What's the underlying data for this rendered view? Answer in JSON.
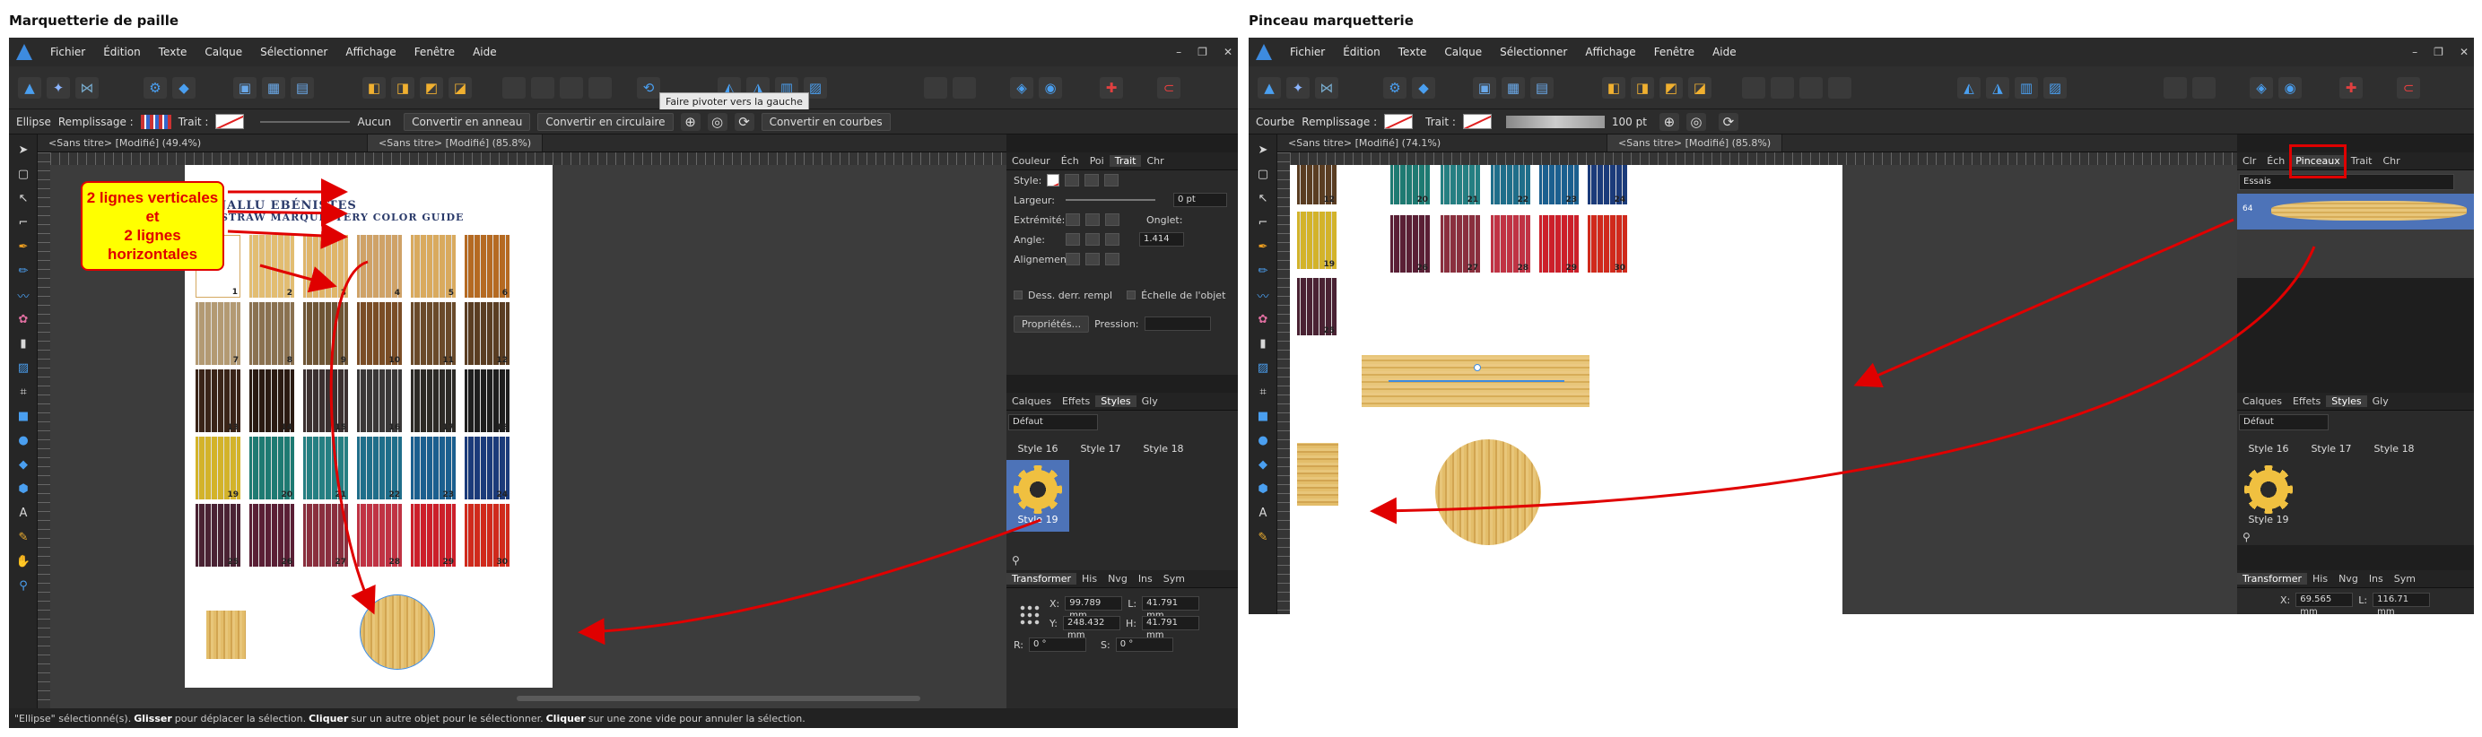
{
  "page_titles": {
    "left": "Marquetterie de paille",
    "right": "Pinceau marquetterie"
  },
  "menu": [
    "Fichier",
    "Édition",
    "Texte",
    "Calque",
    "Sélectionner",
    "Affichage",
    "Fenêtre",
    "Aide"
  ],
  "window_controls": {
    "minimize": "–",
    "restore": "❐",
    "close": "✕"
  },
  "left": {
    "context": {
      "tool": "Ellipse",
      "fill_label": "Remplissage :",
      "stroke_label": "Trait :",
      "stroke_value": "Aucun",
      "btn_ring": "Convertir en anneau",
      "btn_circular": "Convertir en circulaire",
      "btn_curves": "Convertir en courbes"
    },
    "tooltip": "Faire pivoter vers la gauche",
    "tabs": [
      "<Sans titre> [Modifié] (49.4%)",
      "<Sans titre> [Modifié] (85.8%)"
    ],
    "stroke_panel": {
      "tabs": [
        "Couleur",
        "Éch",
        "Poi",
        "Trait",
        "Chr"
      ],
      "style_label": "Style:",
      "rows": [
        {
          "label": "Largeur:",
          "value": "0 pt"
        },
        {
          "label": "Extrémité:",
          "extra_label": "Onglet:"
        },
        {
          "label": "Angle:",
          "extra_value": "1.414"
        },
        {
          "label": "Alignement:"
        }
      ],
      "check1": "Dess. derr. rempl",
      "check2": "Échelle de l'objet",
      "props_button": "Propriétés...",
      "pressure_label": "Pression:"
    },
    "styles_panel": {
      "tabs": [
        "Calques",
        "Effets",
        "Styles",
        "Gly"
      ],
      "category": "Défaut",
      "items": [
        "Style 16",
        "Style 17",
        "Style 18",
        "Style 19"
      ]
    },
    "transform_panel": {
      "tabs": [
        "Transformer",
        "His",
        "Nvg",
        "Ins",
        "Sym"
      ],
      "x_label": "X:",
      "x": "99.789 mm",
      "y_label": "Y:",
      "y": "248.432 mm",
      "w_label": "L:",
      "w": "41.791 mm",
      "h_label": "H:",
      "h": "41.791 mm",
      "r_label": "R:",
      "r": "0 °",
      "s_label": "S:",
      "s": "0 °"
    },
    "document": {
      "brand": "JALLU EBÉNISTES",
      "subtitle": "STRAW MARQUETTERY COLOR GUIDE"
    },
    "swatches": [
      {
        "n": "1",
        "color": "#ffffff"
      },
      {
        "n": "2",
        "color": "#e2bd72"
      },
      {
        "n": "3",
        "color": "#dfb56a"
      },
      {
        "n": "4",
        "color": "#cfa267"
      },
      {
        "n": "5",
        "color": "#d9aa5e"
      },
      {
        "n": "6",
        "color": "#b56a22"
      },
      {
        "n": "7",
        "color": "#b39a73"
      },
      {
        "n": "8",
        "color": "#8a7150"
      },
      {
        "n": "9",
        "color": "#6e5535"
      },
      {
        "n": "10",
        "color": "#7a4d26"
      },
      {
        "n": "11",
        "color": "#6a4a2a"
      },
      {
        "n": "12",
        "color": "#5a3d22"
      },
      {
        "n": "13",
        "color": "#3a2418"
      },
      {
        "n": "14",
        "color": "#2a1a12"
      },
      {
        "n": "15",
        "color": "#3b3030"
      },
      {
        "n": "16",
        "color": "#3a3838"
      },
      {
        "n": "17",
        "color": "#2c2a26"
      },
      {
        "n": "18",
        "color": "#1e1e1e"
      },
      {
        "n": "19",
        "color": "#d3b32a"
      },
      {
        "n": "20",
        "color": "#1e7a72"
      },
      {
        "n": "21",
        "color": "#257f82"
      },
      {
        "n": "22",
        "color": "#1f6e8a"
      },
      {
        "n": "23",
        "color": "#1b5f8f"
      },
      {
        "n": "24",
        "color": "#1b3b7a"
      },
      {
        "n": "25",
        "color": "#4a2233"
      },
      {
        "n": "26",
        "color": "#5a1f35"
      },
      {
        "n": "27",
        "color": "#8a2f3e"
      },
      {
        "n": "28",
        "color": "#c03344"
      },
      {
        "n": "29",
        "color": "#cc1f2a"
      },
      {
        "n": "30",
        "color": "#d02a1c"
      }
    ],
    "callout": [
      "2 lignes verticales",
      "et",
      "2 lignes horizontales"
    ],
    "status": {
      "p1": "\"Ellipse\" sélectionné(s).",
      "b1": "Glisser",
      "p2": "pour déplacer la sélection.",
      "b2": "Cliquer",
      "p3": "sur un autre objet pour le sélectionner.",
      "b3": "Cliquer",
      "p4": "sur une zone vide pour annuler la sélection."
    }
  },
  "right": {
    "context": {
      "tool": "Courbe",
      "fill_label": "Remplissage :",
      "stroke_label": "Trait :",
      "width_value": "100 pt"
    },
    "tabs": [
      "<Sans titre> [Modifié] (74.1%)",
      "<Sans titre> [Modifié] (85.8%)"
    ],
    "brushes_panel": {
      "tabs": [
        "Clr",
        "Éch",
        "Pinceaux",
        "Trait",
        "Chr"
      ],
      "category": "Essais",
      "brush_size": "64"
    },
    "styles_panel": {
      "tabs": [
        "Calques",
        "Effets",
        "Styles",
        "Gly"
      ],
      "category": "Défaut",
      "items": [
        "Style 16",
        "Style 17",
        "Style 18",
        "Style 19"
      ]
    },
    "transform_panel": {
      "tabs": [
        "Transformer",
        "His",
        "Nvg",
        "Ins",
        "Sym"
      ],
      "x_label": "X:",
      "x": "69.565 mm",
      "w_label": "L:",
      "w": "116.71 mm"
    },
    "swatch_numbers": [
      "12",
      "20",
      "21",
      "22",
      "23",
      "24",
      "19",
      "26",
      "27",
      "28",
      "29",
      "30",
      "25"
    ]
  }
}
